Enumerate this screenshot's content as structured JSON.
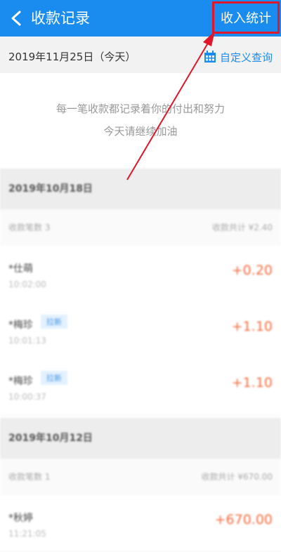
{
  "header": {
    "title": "收款记录",
    "stats_button": "收入统计"
  },
  "date_bar": {
    "date": "2019年11月25日（今天）",
    "custom_query": "自定义查询"
  },
  "empty_message": {
    "line1": "每一笔收款都记录着你的付出和努力",
    "line2": "今天请继续加油"
  },
  "groups": [
    {
      "date": "2019年10月18日",
      "count": "收款笔数 3",
      "total": "收款共计 ¥2.40",
      "records": [
        {
          "name": "*仕萌",
          "tag": "",
          "time": "10:02:00",
          "amount": "+0.20"
        },
        {
          "name": "*梅珍",
          "tag": "拉新",
          "time": "10:01:13",
          "amount": "+1.10"
        },
        {
          "name": "*梅珍",
          "tag": "拉新",
          "time": "10:00:37",
          "amount": "+1.10"
        }
      ]
    },
    {
      "date": "2019年10月12日",
      "count": "收款笔数 1",
      "total": "收款共计 ¥670.00",
      "records": [
        {
          "name": "*秋婷",
          "tag": "",
          "time": "11:21:05",
          "amount": "+670.00"
        }
      ]
    }
  ],
  "colors": {
    "brand": "#1a8cf0",
    "annotation": "#e0172a",
    "amount": "#f26a3d"
  }
}
